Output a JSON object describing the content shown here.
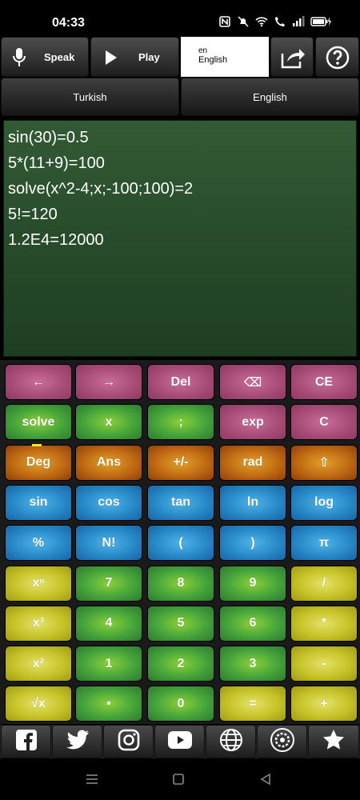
{
  "status": {
    "time": "04:33"
  },
  "toolbar": {
    "speak_label": "Speak",
    "play_label": "Play",
    "lang_code": "en",
    "lang_name": "English"
  },
  "languages": {
    "source": "Turkish",
    "target": "English"
  },
  "display": {
    "lines": [
      "sin(30)=0.5",
      "5*(11+9)=100",
      "solve(x^2-4;x;-100;100)=2",
      "5!=120",
      "1.2E4=12000"
    ]
  },
  "keypad": {
    "rows": [
      [
        {
          "label": "←",
          "color": "pink"
        },
        {
          "label": "→",
          "color": "pink"
        },
        {
          "label": "Del",
          "color": "pink"
        },
        {
          "label": "⌫",
          "color": "pink"
        },
        {
          "label": "CE",
          "color": "pink"
        }
      ],
      [
        {
          "label": "solve",
          "color": "green"
        },
        {
          "label": "x",
          "color": "green"
        },
        {
          "label": ";",
          "color": "green"
        },
        {
          "label": "exp",
          "color": "pink"
        },
        {
          "label": "C",
          "color": "pink"
        }
      ],
      [
        {
          "label": "Deg",
          "color": "orange"
        },
        {
          "label": "Ans",
          "color": "orange"
        },
        {
          "label": "+/-",
          "color": "orange"
        },
        {
          "label": "rad",
          "color": "orange"
        },
        {
          "label": "⇧",
          "color": "orange"
        }
      ],
      [
        {
          "label": "sin",
          "color": "blue"
        },
        {
          "label": "cos",
          "color": "blue"
        },
        {
          "label": "tan",
          "color": "blue"
        },
        {
          "label": "ln",
          "color": "blue"
        },
        {
          "label": "log",
          "color": "blue"
        }
      ],
      [
        {
          "label": "%",
          "color": "blue"
        },
        {
          "label": "N!",
          "color": "blue"
        },
        {
          "label": "(",
          "color": "blue"
        },
        {
          "label": ")",
          "color": "blue"
        },
        {
          "label": "π",
          "color": "blue"
        }
      ],
      [
        {
          "label": "xⁿ",
          "color": "yellow"
        },
        {
          "label": "7",
          "color": "green"
        },
        {
          "label": "8",
          "color": "green"
        },
        {
          "label": "9",
          "color": "green"
        },
        {
          "label": "/",
          "color": "yellow"
        }
      ],
      [
        {
          "label": "x³",
          "color": "yellow"
        },
        {
          "label": "4",
          "color": "green"
        },
        {
          "label": "5",
          "color": "green"
        },
        {
          "label": "6",
          "color": "green"
        },
        {
          "label": "*",
          "color": "yellow"
        }
      ],
      [
        {
          "label": "x²",
          "color": "yellow"
        },
        {
          "label": "1",
          "color": "green"
        },
        {
          "label": "2",
          "color": "green"
        },
        {
          "label": "3",
          "color": "green"
        },
        {
          "label": "-",
          "color": "yellow"
        }
      ],
      [
        {
          "label": "√x",
          "color": "yellow"
        },
        {
          "label": "•",
          "color": "green"
        },
        {
          "label": "0",
          "color": "green"
        },
        {
          "label": "=",
          "color": "yellow"
        },
        {
          "label": "+",
          "color": "yellow"
        }
      ]
    ]
  },
  "social": {
    "icons": [
      "facebook-icon",
      "twitter-icon",
      "instagram-icon",
      "youtube-icon",
      "globe-icon",
      "settings-gear-icon",
      "star-icon"
    ]
  },
  "colors": {
    "display_bg": "#2a4d2e",
    "pink": "#a64a76",
    "green": "#45a43a",
    "orange": "#c06a14",
    "blue": "#2889c8",
    "yellow": "#c6c228"
  }
}
